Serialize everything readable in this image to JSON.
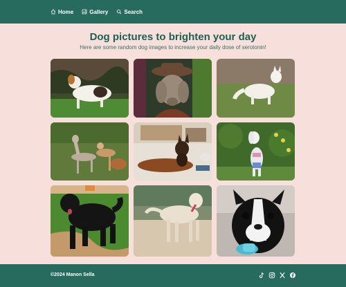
{
  "nav": {
    "items": [
      {
        "label": "Home",
        "icon": "home-icon"
      },
      {
        "label": "Gallery",
        "icon": "gallery-icon"
      },
      {
        "label": "Search",
        "icon": "search-icon"
      }
    ]
  },
  "main": {
    "title": "Dog pictures to brighten your day",
    "subtitle": "Here are some random dog images to increase your daily dose of serotonin!"
  },
  "gallery": {
    "images": [
      {
        "subject": "jack-russell-terrier-on-grass"
      },
      {
        "subject": "weimaraner-in-hat"
      },
      {
        "subject": "white-shepherd-on-grass"
      },
      {
        "subject": "greyhounds-in-field"
      },
      {
        "subject": "doberman-lying-on-floor"
      },
      {
        "subject": "small-dog-with-flowers"
      },
      {
        "subject": "black-newfoundland-standing"
      },
      {
        "subject": "cream-dog-on-dirt-ground"
      },
      {
        "subject": "boston-terrier-puppy-with-toy"
      }
    ]
  },
  "footer": {
    "copyright": "©2024 Manon Sella",
    "socials": [
      "tiktok-icon",
      "instagram-icon",
      "x-icon",
      "facebook-icon"
    ]
  },
  "colors": {
    "header_bg": "#266b5e",
    "page_bg": "#f7e0dc",
    "title": "#1f5f52"
  }
}
